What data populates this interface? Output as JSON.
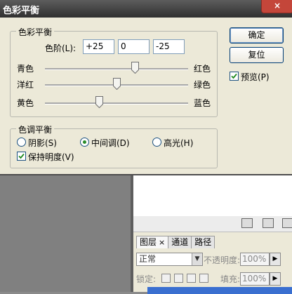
{
  "dialog": {
    "title": "色彩平衡",
    "color_balance_group": {
      "legend": "色彩平衡",
      "levels_label": "色阶(L):",
      "levels": [
        "+25",
        "0",
        "-25"
      ],
      "sliders": [
        {
          "left": "青色",
          "right": "红色",
          "value": 25
        },
        {
          "left": "洋红",
          "right": "绿色",
          "value": 0
        },
        {
          "left": "黄色",
          "right": "蓝色",
          "value": -25
        }
      ]
    },
    "tone_balance_group": {
      "legend": "色调平衡",
      "options": [
        {
          "label": "阴影(S)",
          "selected": false
        },
        {
          "label": "中间调(D)",
          "selected": true
        },
        {
          "label": "高光(H)",
          "selected": false
        }
      ],
      "preserve_luminosity": {
        "label": "保持明度(V)",
        "checked": true
      }
    },
    "buttons": {
      "ok": "确定",
      "reset": "复位"
    },
    "preview": {
      "label": "预览(P)",
      "checked": true
    }
  },
  "layers_panel": {
    "tabs": [
      {
        "label": "图层",
        "close": "×"
      },
      {
        "label": "通道"
      },
      {
        "label": "路径"
      }
    ],
    "blend_mode": "正常",
    "opacity_label": "不透明度:",
    "opacity": "100%",
    "lock_label": "锁定:",
    "fill_label": "填充:",
    "fill": "100%"
  },
  "colors": {
    "titlebar": "#3f3f3f",
    "dialog_bg": "#ece9d8",
    "radio_dot": "#2a8c2a",
    "close": "#c4463a"
  }
}
